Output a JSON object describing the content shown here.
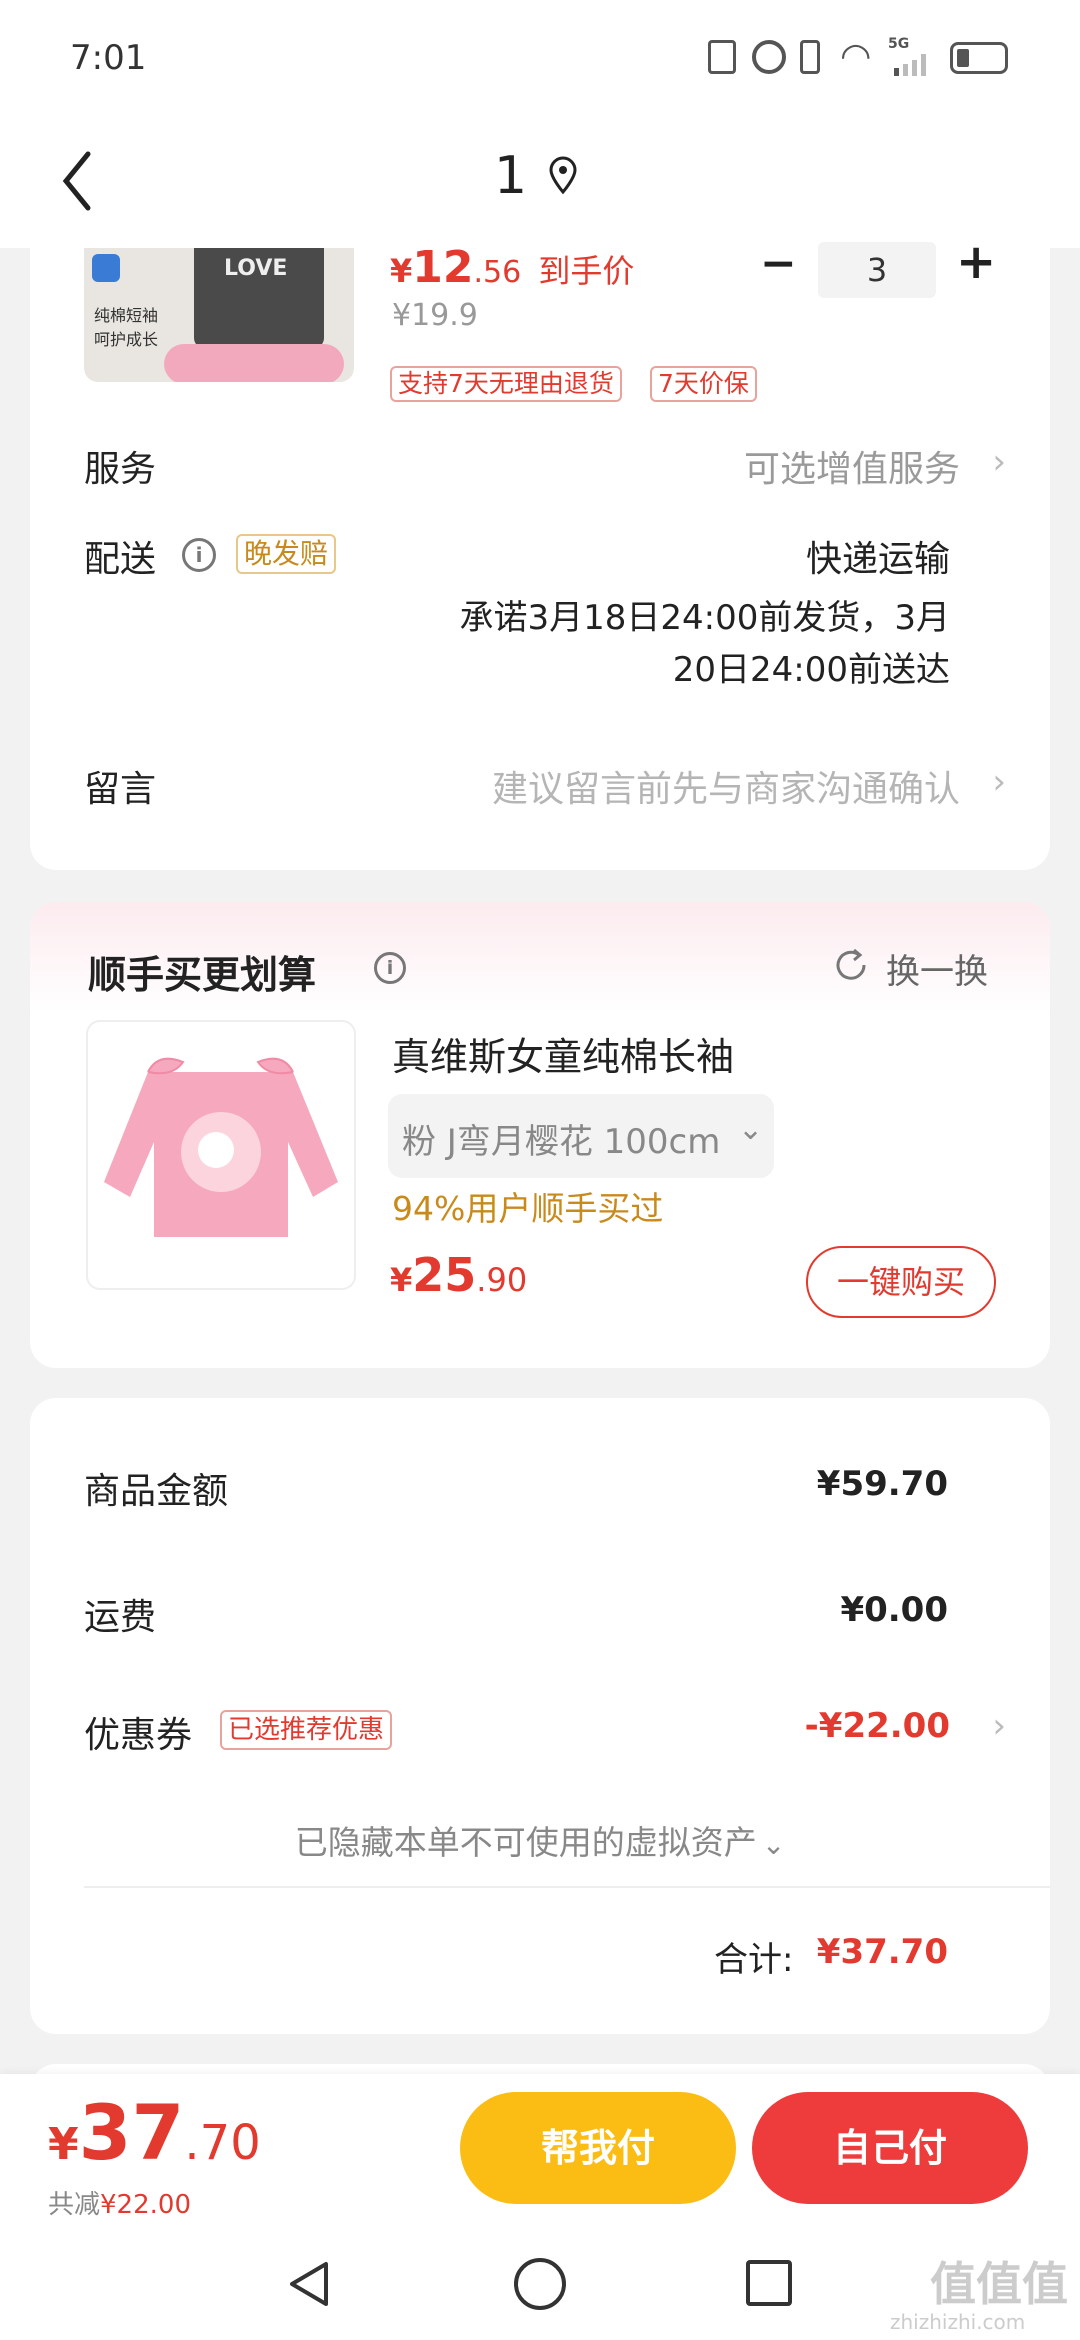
{
  "status": {
    "time": "7:01",
    "network": "5G"
  },
  "header": {
    "title": "1"
  },
  "product": {
    "price_prefix": "¥",
    "price_int": "12",
    "price_dec": ".56",
    "price_tag": "到手价",
    "orig_price": "¥19.9",
    "tags": [
      "支持7天无理由退货",
      "7天价保"
    ],
    "quantity": "3",
    "minus": "−",
    "plus": "+",
    "thumb_text_1": "纯棉短袖",
    "thumb_text_2": "呵护成长",
    "thumb_shirt_text": "LOVE"
  },
  "service": {
    "label": "服务",
    "value": "可选增值服务"
  },
  "delivery": {
    "label": "配送",
    "badge": "晚发赔",
    "method": "快递运输",
    "promise_1": "承诺3月18日24:00前发货，3月",
    "promise_2": "20日24:00前送达"
  },
  "message": {
    "label": "留言",
    "placeholder": "建议留言前先与商家沟通确认"
  },
  "upsell": {
    "title": "顺手买更划算",
    "refresh": "换一换",
    "name": "真维斯女童纯棉长袖",
    "spec": "粉 J弯月樱花   100cm",
    "social": "94%用户顺手买过",
    "price_prefix": "¥",
    "price_int": "25",
    "price_dec": ".90",
    "buy_button": "一键购买"
  },
  "summary": {
    "goods_label": "商品金额",
    "goods_value": "¥59.70",
    "shipping_label": "运费",
    "shipping_value": "¥0.00",
    "coupon_label": "优惠券",
    "coupon_badge": "已选推荐优惠",
    "coupon_value": "-¥22.00",
    "hidden_assets": "已隐藏本单不可使用的虚拟资产",
    "total_label": "合计:",
    "total_value": "¥37.70"
  },
  "bottom": {
    "price_prefix": "¥",
    "price_int": "37",
    "price_dec": ".70",
    "saved_label": "共减",
    "saved_value": "¥22.00",
    "help_pay": "帮我付",
    "self_pay": "自己付"
  },
  "watermark": {
    "site": "zhizhizhi.com",
    "logo": "值值值"
  },
  "colors": {
    "accent": "#e23a2e",
    "gold": "#c98a1c",
    "help_btn": "#fbbd14",
    "pay_btn": "#ee3b3b"
  }
}
